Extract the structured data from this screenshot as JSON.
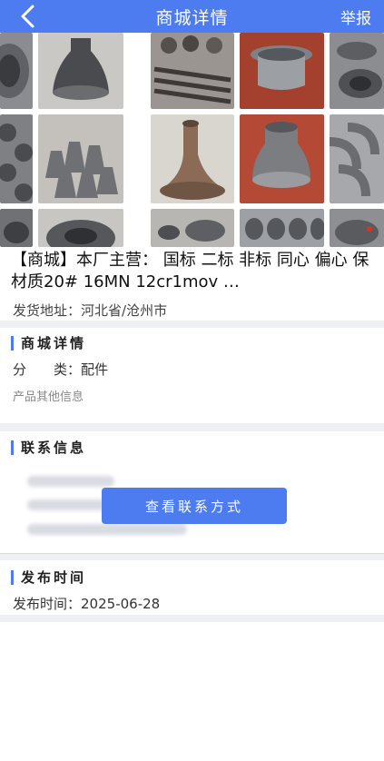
{
  "header": {
    "title": "商城详情",
    "report_label": "举报"
  },
  "product": {
    "title": "【商城】本厂主营： 国标 二标 非标 同心 偏心 保材质20#        16MN 12cr1mov …",
    "address_label": "发货地址：",
    "address_value": "河北省/沧州市"
  },
  "details_section": {
    "title": "商城详情",
    "category_label": "分　　类：",
    "category_value": "配件",
    "other_info": "产品其他信息"
  },
  "contact_section": {
    "title": "联系信息",
    "view_contact_label": "查看联系方式"
  },
  "publish_section": {
    "title": "发布时间",
    "publish_label": "发布时间：",
    "publish_value": "2025-06-28"
  },
  "colors": {
    "accent": "#4c7cf0",
    "background_gap": "#eef0f4"
  }
}
